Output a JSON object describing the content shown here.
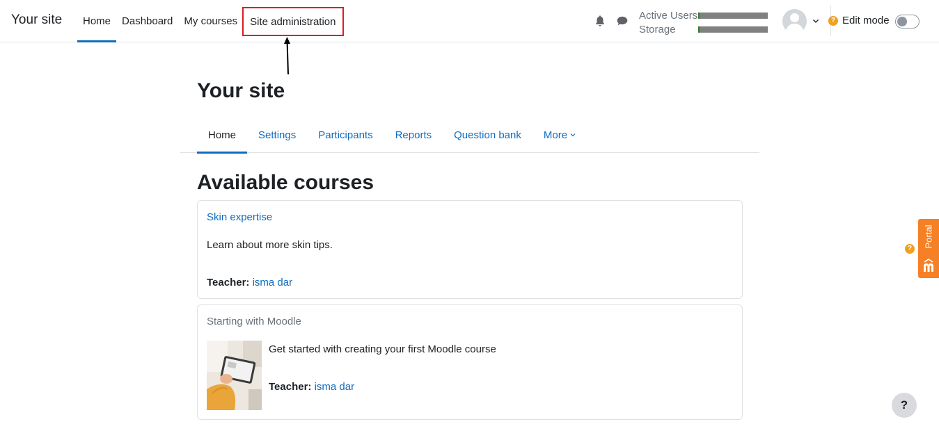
{
  "navbar": {
    "brand": "Your site",
    "primary_nav": [
      {
        "label": "Home"
      },
      {
        "label": "Dashboard"
      },
      {
        "label": "My courses"
      },
      {
        "label": "Site administration"
      }
    ],
    "usage": {
      "active_users_label": "Active Users",
      "storage_label": "Storage"
    },
    "edit_mode_label": "Edit mode",
    "edit_mode_on": false
  },
  "page": {
    "title": "Your site",
    "secondary_nav": [
      {
        "label": "Home"
      },
      {
        "label": "Settings"
      },
      {
        "label": "Participants"
      },
      {
        "label": "Reports"
      },
      {
        "label": "Question bank"
      },
      {
        "label": "More"
      }
    ],
    "section_title": "Available courses"
  },
  "courses": [
    {
      "name": "Skin expertise",
      "summary": "Learn about more skin tips.",
      "teacher_role": "Teacher:",
      "teacher_name": "isma dar"
    },
    {
      "name": "Starting with Moodle",
      "summary": "Get started with creating your first Moodle course",
      "teacher_role": "Teacher:",
      "teacher_name": "isma dar"
    }
  ],
  "portal": {
    "label": "Portal"
  },
  "help_fab": {
    "symbol": "?"
  },
  "colors": {
    "primary": "#0f6cbf",
    "highlight_box": "#e01b24",
    "portal_orange": "#f58025",
    "help_orange": "#f0a01d",
    "usage_bar": "#808080"
  },
  "icons": [
    "bell-icon",
    "chat-icon",
    "user-avatar",
    "chevron-down-icon",
    "question-circle-icon",
    "moodle-logo-icon",
    "annotation-arrow"
  ]
}
